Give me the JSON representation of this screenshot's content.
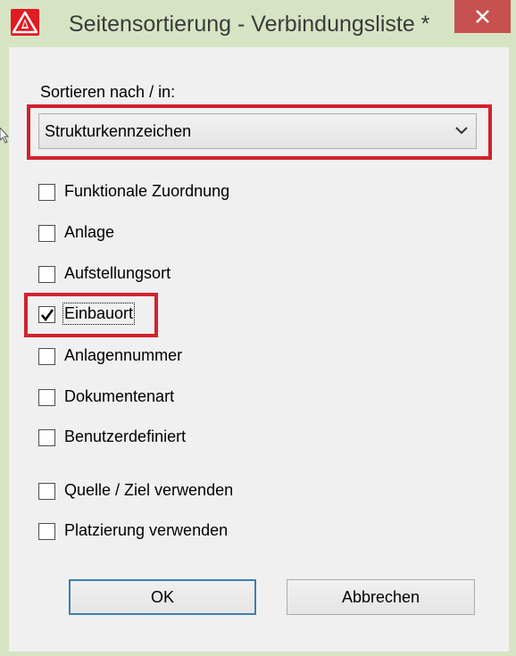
{
  "window": {
    "title": "Seitensortierung - Verbindungsliste *",
    "close_label": "close"
  },
  "colors": {
    "titlebar": "#d7e4c4",
    "close_button": "#c75050",
    "highlight": "#d0222e",
    "client": "#f0f0f0"
  },
  "sort": {
    "label": "Sortieren nach / in:",
    "selected": "Strukturkennzeichen"
  },
  "options": [
    {
      "label": "Funktionale Zuordnung",
      "checked": false
    },
    {
      "label": "Anlage",
      "checked": false
    },
    {
      "label": "Aufstellungsort",
      "checked": false
    },
    {
      "label": "Einbauort",
      "checked": true
    },
    {
      "label": "Anlagennummer",
      "checked": false
    },
    {
      "label": "Dokumentenart",
      "checked": false
    },
    {
      "label": "Benutzerdefiniert",
      "checked": false
    }
  ],
  "extra_options": [
    {
      "label": "Quelle / Ziel verwenden",
      "checked": false
    },
    {
      "label": "Platzierung verwenden",
      "checked": false
    }
  ],
  "buttons": {
    "ok": "OK",
    "cancel": "Abbrechen"
  }
}
